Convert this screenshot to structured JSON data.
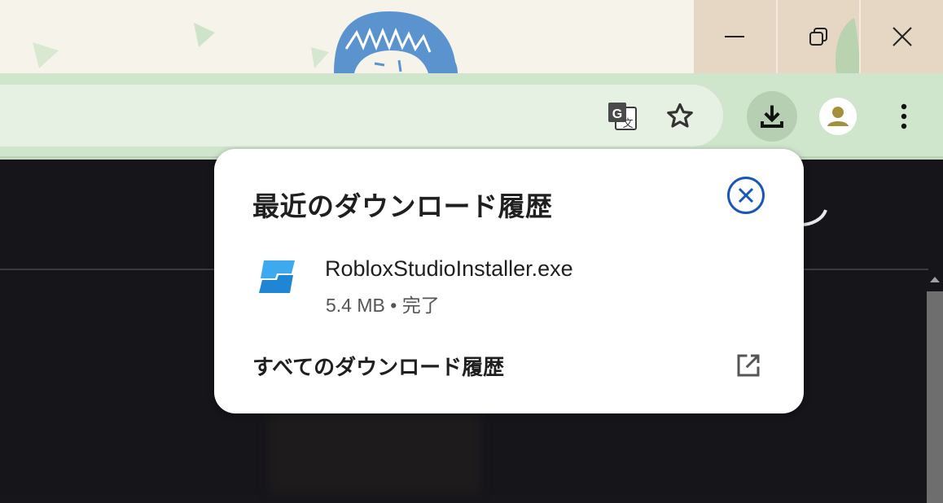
{
  "window": {
    "controls": [
      {
        "name": "minimize-button",
        "icon": "minimize-icon"
      },
      {
        "name": "restore-button",
        "icon": "restore-icon"
      },
      {
        "name": "close-window-button",
        "icon": "close-icon"
      }
    ]
  },
  "toolbar": {
    "icons": [
      "translate-icon",
      "star-icon",
      "download-icon",
      "profile-avatar-icon",
      "more-vert-icon"
    ]
  },
  "download_bubble": {
    "title": "最近のダウンロード履歴",
    "items": [
      {
        "file_name": "RobloxStudioInstaller.exe",
        "size": "5.4 MB",
        "separator": "•",
        "status": "完了",
        "icon": "roblox-studio-icon"
      }
    ],
    "all_downloads_label": "すべてのダウンロード履歴",
    "open_icon": "open-in-new-icon",
    "close_icon": "close-circle-icon"
  },
  "colors": {
    "titlebar_bg": "#f6f4ea",
    "window_controls_bg": "#e6d7c4",
    "toolbar_bg": "#cfe5cc",
    "omnibox_bg": "#e6f1e3",
    "page_bg": "#15151a",
    "accent_blue": "#1a56b8",
    "roblox_blue": "#2b9ae3"
  }
}
